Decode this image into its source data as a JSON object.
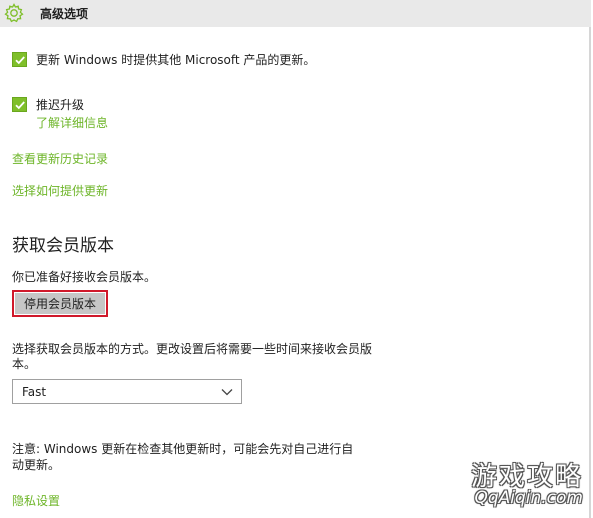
{
  "header": {
    "title": "高级选项",
    "icon": "gear-icon"
  },
  "options": [
    {
      "label": "更新 Windows 时提供其他 Microsoft 产品的更新。",
      "checked": true
    },
    {
      "label": "推迟升级",
      "checked": true,
      "link": "了解详细信息"
    }
  ],
  "links": {
    "view_history": "查看更新历史记录",
    "choose_delivery": "选择如何提供更新"
  },
  "insider": {
    "heading": "获取会员版本",
    "ready_text": "你已准备好接收会员版本。",
    "stop_button": "停用会员版本",
    "choose_text": "选择获取会员版本的方式。更改设置后将需要一些时间来接收会员版本。",
    "ring_selected": "Fast"
  },
  "note": "注意: Windows 更新在检查其他更新时，可能会先对自己进行自动更新。",
  "privacy_link": "隐私设置",
  "watermark": {
    "main": "游戏攻略",
    "sub": "QqAiqin.com"
  },
  "colors": {
    "accent": "#7fbf2a",
    "link": "#6db528",
    "highlight_border": "#d0192b",
    "button_bg": "#c6c6c6",
    "titlebar_bg": "#e9e9e9"
  }
}
